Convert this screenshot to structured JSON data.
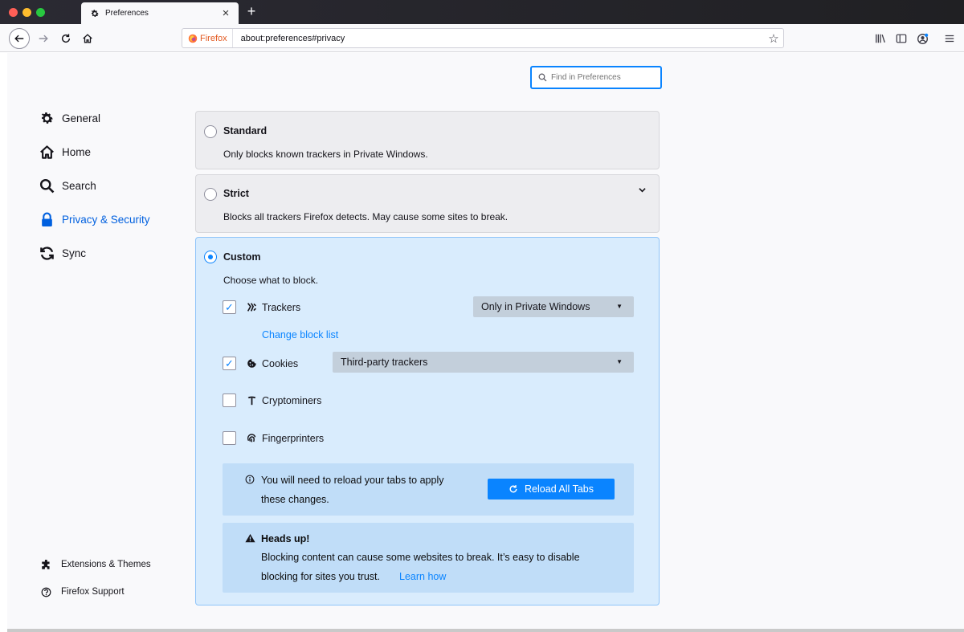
{
  "window": {
    "tab_title": "Preferences",
    "tab_icon": "gear-icon"
  },
  "navbar": {
    "identity_label": "Firefox",
    "url": "about:preferences#privacy"
  },
  "search": {
    "placeholder": "Find in Preferences"
  },
  "sidebar": {
    "items": [
      {
        "label": "General",
        "icon": "gear-icon"
      },
      {
        "label": "Home",
        "icon": "home-icon"
      },
      {
        "label": "Search",
        "icon": "search-icon"
      },
      {
        "label": "Privacy & Security",
        "icon": "lock-icon",
        "selected": true
      },
      {
        "label": "Sync",
        "icon": "sync-icon"
      }
    ],
    "footer": [
      {
        "label": "Extensions & Themes",
        "icon": "puzzle-icon"
      },
      {
        "label": "Firefox Support",
        "icon": "help-icon"
      }
    ]
  },
  "options": {
    "standard": {
      "title": "Standard",
      "description": "Only blocks known trackers in Private Windows.",
      "selected": false
    },
    "strict": {
      "title": "Strict",
      "description": "Blocks all trackers Firefox detects. May cause some sites to break.",
      "selected": false
    },
    "custom": {
      "title": "Custom",
      "description": "Choose what to block.",
      "selected": true,
      "trackers": {
        "label": "Trackers",
        "checked": true,
        "select_value": "Only in Private Windows",
        "link": "Change block list"
      },
      "cookies": {
        "label": "Cookies",
        "checked": true,
        "select_value": "Third-party trackers"
      },
      "cryptominers": {
        "label": "Cryptominers",
        "checked": false
      },
      "fingerprinters": {
        "label": "Fingerprinters",
        "checked": false
      },
      "reload_notice": {
        "line1": "You will need to reload your tabs to apply",
        "line2": "these changes.",
        "button": "Reload All Tabs"
      },
      "heads_up": {
        "title": "Heads up!",
        "line1": "Blocking content can cause some websites to break. It’s easy to disable",
        "line2": "blocking for sites you trust.",
        "link": "Learn how"
      }
    }
  },
  "colors": {
    "accent": "#0a84ff",
    "selected_nav": "#0060df",
    "custom_card_bg": "#d9ecfd",
    "notice_bg": "#c0ddf8"
  }
}
